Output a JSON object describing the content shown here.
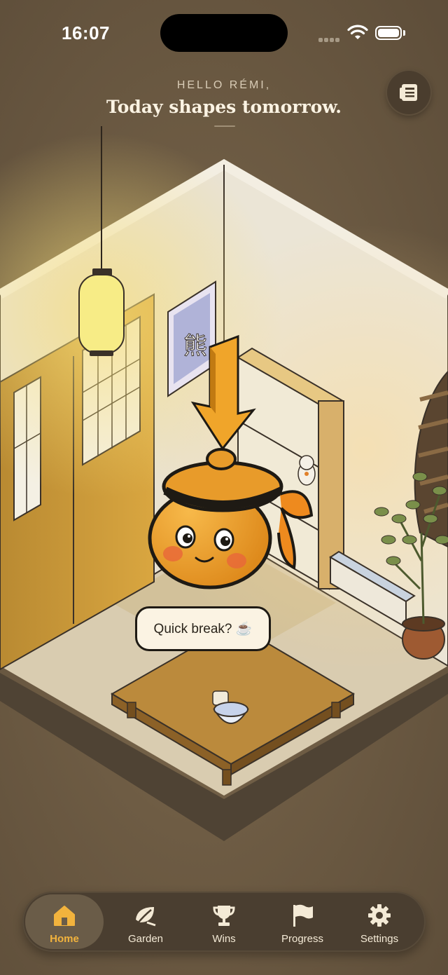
{
  "status_bar": {
    "time": "16:07"
  },
  "header": {
    "greeting": "HELLO RÉMI,",
    "tagline": "Today shapes tomorrow."
  },
  "scene": {
    "speech_bubble": "Quick break? ☕"
  },
  "tab_bar": {
    "tabs": [
      {
        "label": "Home",
        "icon": "home-icon",
        "active": true
      },
      {
        "label": "Garden",
        "icon": "leaf-icon",
        "active": false
      },
      {
        "label": "Wins",
        "icon": "trophy-icon",
        "active": false
      },
      {
        "label": "Progress",
        "icon": "flag-icon",
        "active": false
      },
      {
        "label": "Settings",
        "icon": "gear-icon",
        "active": false
      }
    ]
  },
  "colors": {
    "background": "#6b5a43",
    "accent": "#f2b33d",
    "tab_bar": "#4a3e30"
  }
}
